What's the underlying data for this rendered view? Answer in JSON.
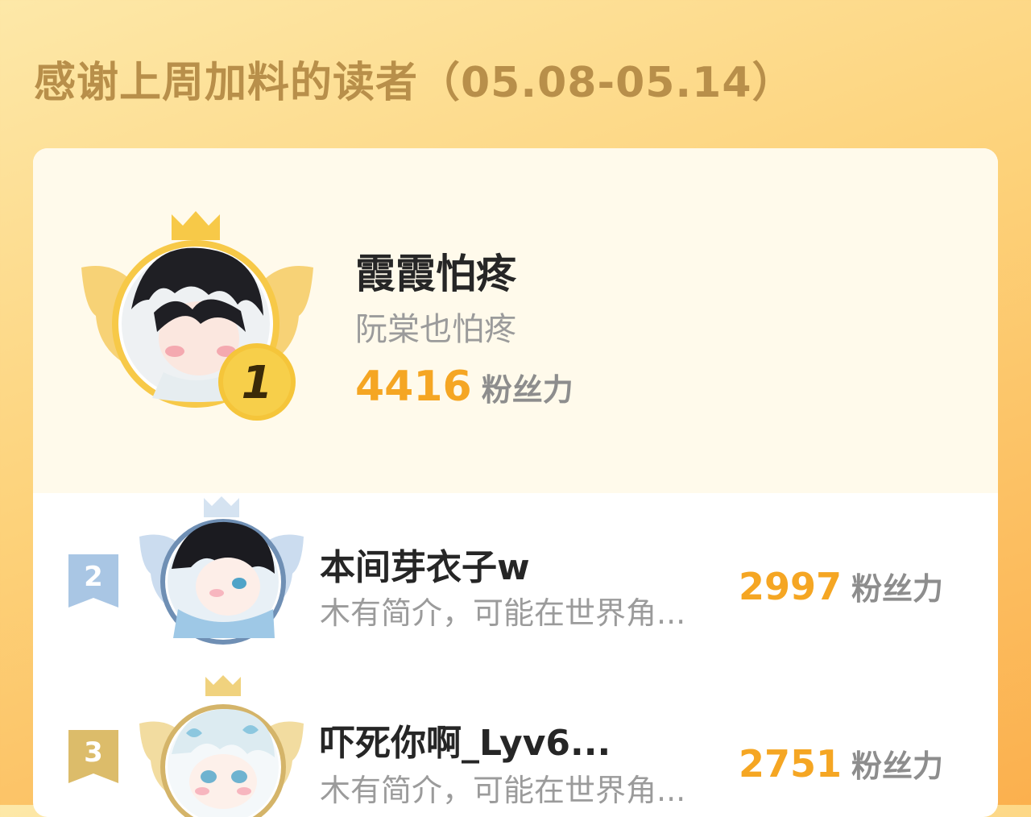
{
  "title": "感谢上周加料的读者（05.08-05.14）",
  "score_unit": "粉丝力",
  "first": {
    "rank": "1",
    "name": "霞霞怕疼",
    "bio": "阮棠也怕疼",
    "score": "4416"
  },
  "others": [
    {
      "rank": "2",
      "name": "本间芽衣子w",
      "bio": "木有简介，可能在世界角...",
      "score": "2997"
    },
    {
      "rank": "3",
      "name": "吓死你啊_Lyv6...",
      "bio": "木有简介，可能在世界角...",
      "score": "2751"
    }
  ],
  "colors": {
    "accent": "#f5a623",
    "gold": "#f7c948",
    "silver": "#9fbddc",
    "bronze": "#d9b45a"
  },
  "icons": [
    "crown-icon",
    "wing-icon",
    "avatar"
  ]
}
